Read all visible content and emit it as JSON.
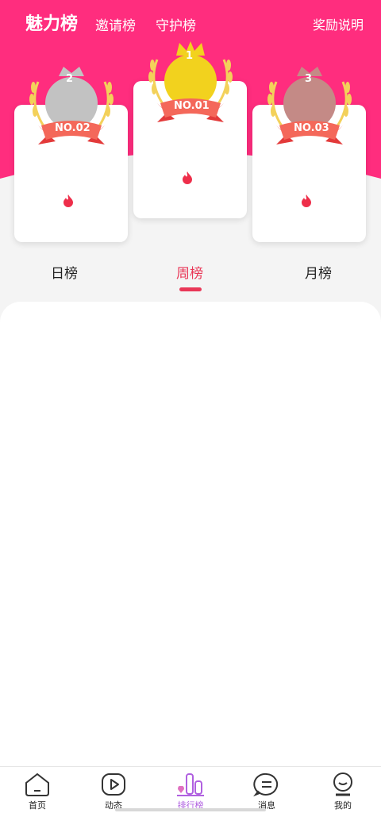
{
  "top_tabs": {
    "charm": "魅力榜",
    "invite": "邀请榜",
    "guard": "守护榜",
    "reward_info": "奖励说明"
  },
  "podium": [
    {
      "rank_number": "2",
      "rank_label": "NO.02",
      "medal_color": "#c2c2c2"
    },
    {
      "rank_number": "1",
      "rank_label": "NO.01",
      "medal_color": "#f2d21e"
    },
    {
      "rank_number": "3",
      "rank_label": "NO.03",
      "medal_color": "#c48a86"
    }
  ],
  "period_tabs": {
    "day": "日榜",
    "week": "周榜",
    "month": "月榜",
    "active": "week"
  },
  "bottom_nav": [
    {
      "label": "首页",
      "icon": "home-icon"
    },
    {
      "label": "动态",
      "icon": "play-icon"
    },
    {
      "label": "排行榜",
      "icon": "ranking-icon"
    },
    {
      "label": "消息",
      "icon": "message-icon"
    },
    {
      "label": "我的",
      "icon": "profile-icon"
    }
  ],
  "colors": {
    "brand_pink": "#ff2d7e",
    "active_red": "#e93757",
    "active_purple": "#b060e0"
  }
}
